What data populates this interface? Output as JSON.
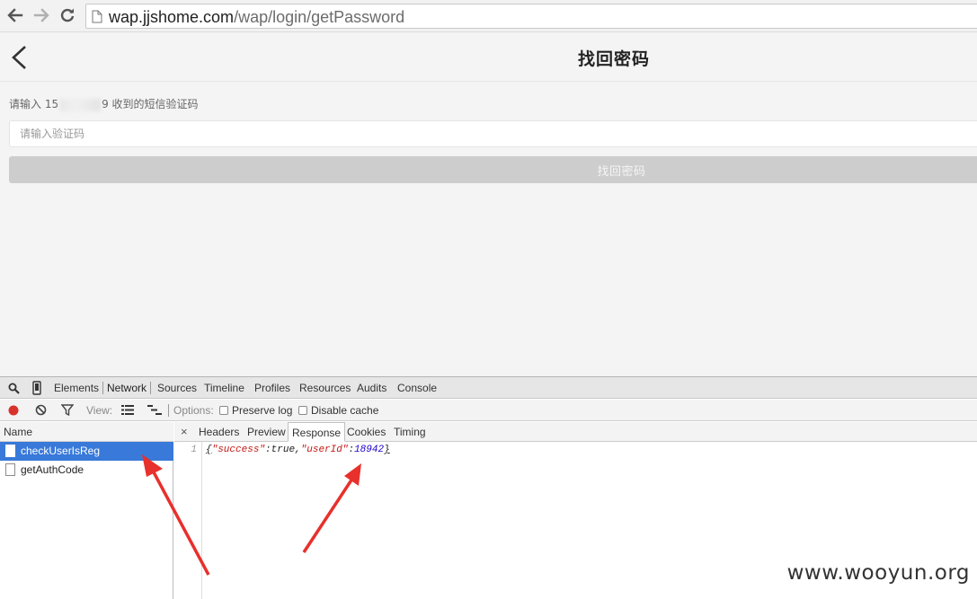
{
  "browser": {
    "url_host": "wap.jjshome.com",
    "url_path": "/wap/login/getPassword"
  },
  "page": {
    "title": "找回密码",
    "hint_prefix": "请输入 15",
    "hint_suffix": "9 收到的短信验证码",
    "code_placeholder": "请输入验证码",
    "submit_label": "找回密码"
  },
  "devtools": {
    "tabs": [
      "Elements",
      "Network",
      "Sources",
      "Timeline",
      "Profiles",
      "Resources",
      "Audits",
      "Console"
    ],
    "active_tab": "Network",
    "view_label": "View:",
    "options_label": "Options:",
    "preserve_log": "Preserve log",
    "disable_cache": "Disable cache",
    "name_header": "Name",
    "requests": [
      "checkUserIsReg",
      "getAuthCode"
    ],
    "selected_request": "checkUserIsReg",
    "detail_tabs": [
      "Headers",
      "Preview",
      "Response",
      "Cookies",
      "Timing"
    ],
    "active_detail_tab": "Response",
    "close_glyph": "×",
    "response": {
      "line_number": "1",
      "open": "{",
      "key1": "\"success\"",
      "colon1": ":",
      "val1": "true",
      "comma": ",",
      "key2": "\"userId\"",
      "colon2": ":",
      "val2": "18942",
      "close": "}"
    }
  },
  "watermark": "www.wooyun.org",
  "colors": {
    "selection": "#3879d9",
    "annotation_arrow": "#e8302c",
    "json_key": "#c41a16",
    "json_number": "#1c00cf"
  }
}
